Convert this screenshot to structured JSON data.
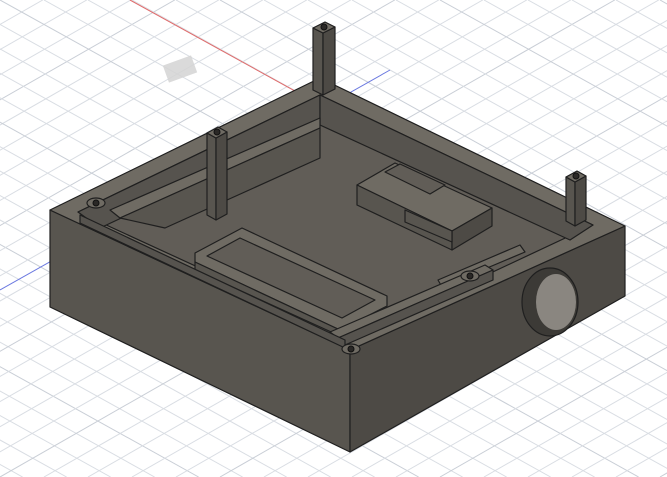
{
  "viewport": {
    "background": "#ffffff",
    "grid_color": "#d9dde3",
    "grid_major_color": "#c9ced6",
    "axis_x_color": "#e06a6a",
    "axis_y_color": "#6a78e0"
  },
  "model": {
    "top_color": "#6f6b63",
    "left_face_color": "#58554f",
    "right_face_color": "#4d4a45",
    "floor_color": "#615d57",
    "inner_wall_color": "#56534e",
    "edge_color": "#1f1f1f",
    "hole_color": "#8a8680"
  }
}
